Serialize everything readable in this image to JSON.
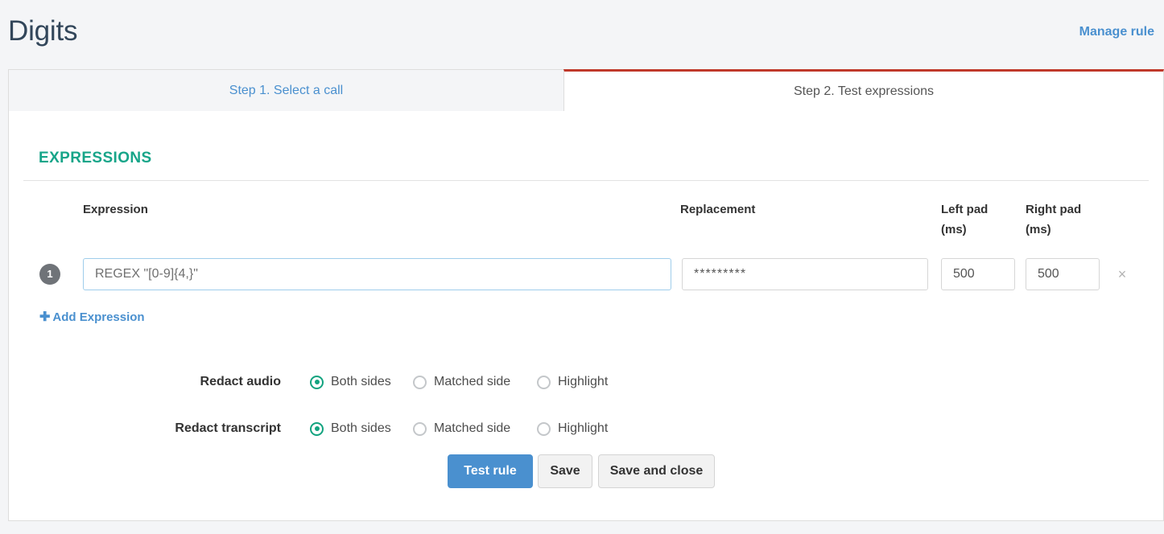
{
  "header": {
    "title": "Digits",
    "manage_rule_label": "Manage rule"
  },
  "tabs": [
    {
      "label": "Step 1. Select a call",
      "active": false
    },
    {
      "label": "Step 2. Test expressions",
      "active": true
    }
  ],
  "expressions_section": {
    "title": "EXPRESSIONS",
    "columns": {
      "expression": "Expression",
      "replacement": "Replacement",
      "left_pad": "Left pad",
      "left_pad_unit": "(ms)",
      "right_pad": "Right pad",
      "right_pad_unit": "(ms)"
    },
    "rows": [
      {
        "index": "1",
        "expression_value": "REGEX \"[0-9]{4,}\"",
        "expression_placeholder": "REGEX \"[0-9]{4,}\"",
        "replacement_value": "*********",
        "replacement_placeholder": "*********",
        "left_pad_value": "500",
        "right_pad_value": "500",
        "remove_icon": "close-icon",
        "remove_glyph": "×"
      }
    ],
    "add_expression_label": "Add Expression",
    "add_expression_glyph": "✚"
  },
  "options": {
    "redact_audio": {
      "label": "Redact audio",
      "choices": [
        "Both sides",
        "Matched side",
        "Highlight"
      ],
      "selected": "Both sides"
    },
    "redact_transcript": {
      "label": "Redact transcript",
      "choices": [
        "Both sides",
        "Matched side",
        "Highlight"
      ],
      "selected": "Both sides"
    }
  },
  "actions": {
    "test_rule": "Test rule",
    "save": "Save",
    "save_and_close": "Save and close"
  },
  "colors": {
    "accent_teal": "#17a589",
    "link_blue": "#4a90cf",
    "active_tab_border": "#c0392b",
    "title_navy": "#32465a",
    "radio_selected": "#12a37f",
    "badge_gray": "#6f7378"
  }
}
